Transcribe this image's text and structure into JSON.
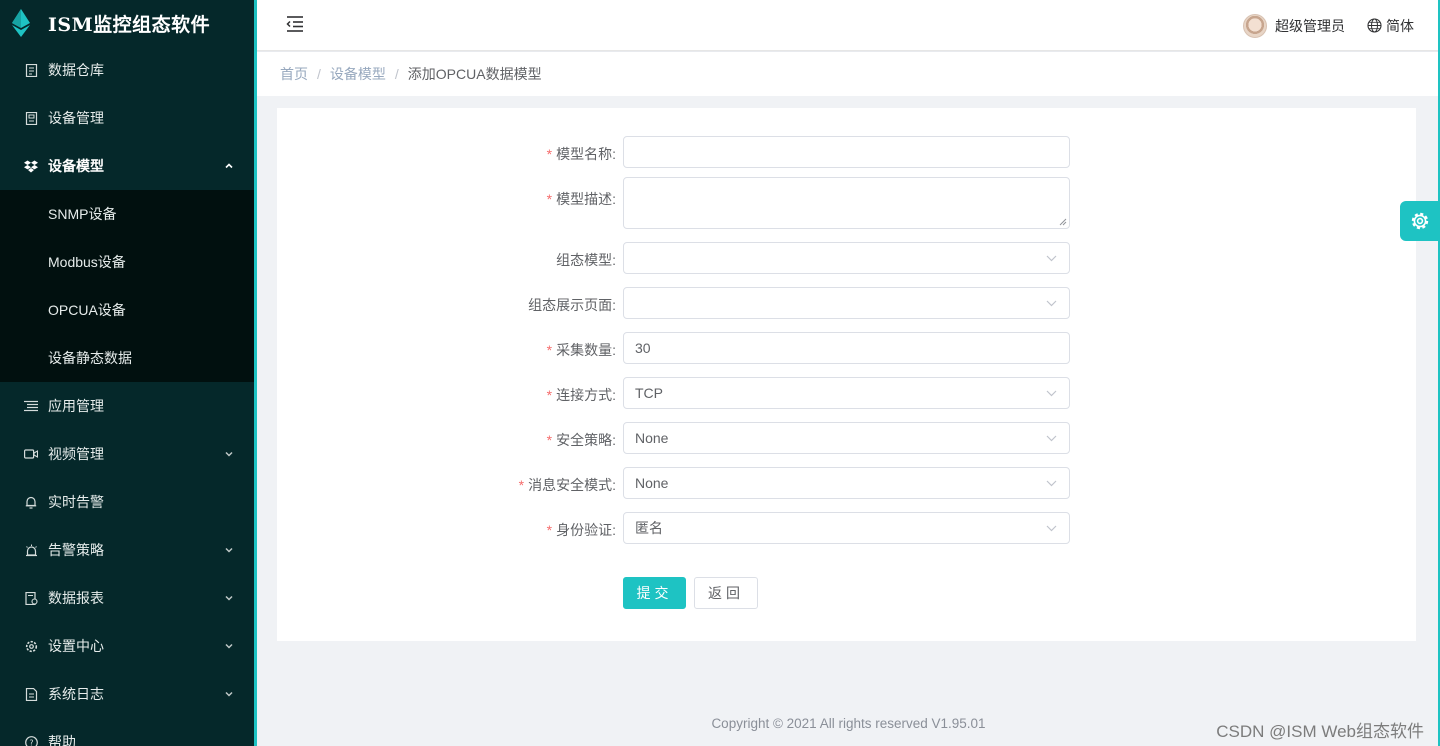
{
  "app": {
    "title": "ISM监控组态软件"
  },
  "sidebar": {
    "items": [
      {
        "label": "数据仓库",
        "icon": "document-icon"
      },
      {
        "label": "设备管理",
        "icon": "device-icon"
      },
      {
        "label": "设备模型",
        "icon": "dropbox-icon",
        "expanded": true,
        "children": [
          {
            "label": "SNMP设备"
          },
          {
            "label": "Modbus设备"
          },
          {
            "label": "OPCUA设备"
          },
          {
            "label": "设备静态数据"
          }
        ]
      },
      {
        "label": "应用管理",
        "icon": "list-icon"
      },
      {
        "label": "视频管理",
        "icon": "video-icon"
      },
      {
        "label": "实时告警",
        "icon": "bell-icon"
      },
      {
        "label": "告警策略",
        "icon": "alarm-icon"
      },
      {
        "label": "数据报表",
        "icon": "report-icon"
      },
      {
        "label": "设置中心",
        "icon": "gear-icon"
      },
      {
        "label": "系统日志",
        "icon": "log-icon"
      },
      {
        "label": "帮助",
        "icon": "help-icon"
      }
    ]
  },
  "header": {
    "user": "超级管理员",
    "language": "简体"
  },
  "breadcrumb": {
    "home": "首页",
    "parent": "设备模型",
    "current": "添加OPCUA数据模型"
  },
  "form": {
    "model_name": {
      "label": "模型名称:",
      "required": true,
      "value": ""
    },
    "model_desc": {
      "label": "模型描述:",
      "required": true,
      "value": ""
    },
    "config_model": {
      "label": "组态模型:",
      "required": false,
      "value": ""
    },
    "config_page": {
      "label": "组态展示页面:",
      "required": false,
      "value": ""
    },
    "sample_count": {
      "label": "采集数量:",
      "required": true,
      "value": "30"
    },
    "connect_mode": {
      "label": "连接方式:",
      "required": true,
      "value": "TCP"
    },
    "security_policy": {
      "label": "安全策略:",
      "required": true,
      "value": "None"
    },
    "msg_security_mode": {
      "label": "消息安全模式:",
      "required": true,
      "value": "None"
    },
    "auth": {
      "label": "身份验证:",
      "required": true,
      "value": "匿名"
    },
    "submit_label": "提交",
    "back_label": "返回"
  },
  "footer": {
    "copyright": "Copyright © 2021 All rights reserved V1.95.01",
    "watermark": "CSDN @ISM Web组态软件"
  },
  "colors": {
    "accent": "#1ec3c3",
    "sidebar": "#05282a",
    "required": "#f56c6c"
  }
}
